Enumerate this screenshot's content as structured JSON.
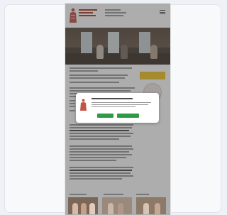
{
  "site": {
    "logo_text": "",
    "header_info": ""
  },
  "modal": {
    "title": "",
    "body": "",
    "accept_label": "",
    "settings_label": ""
  },
  "content": {
    "cta_label": ""
  },
  "sections": [
    {
      "label": ""
    },
    {
      "label": ""
    },
    {
      "label": ""
    }
  ],
  "colors": {
    "brand_red": "#b23b2e",
    "cta_yellow": "#f2c524",
    "button_green": "#2e9b49",
    "overlay": "rgba(60,60,60,0.42)"
  },
  "icons": [
    "menu-icon",
    "museum-logo-figure",
    "cookie-figure-icon"
  ]
}
